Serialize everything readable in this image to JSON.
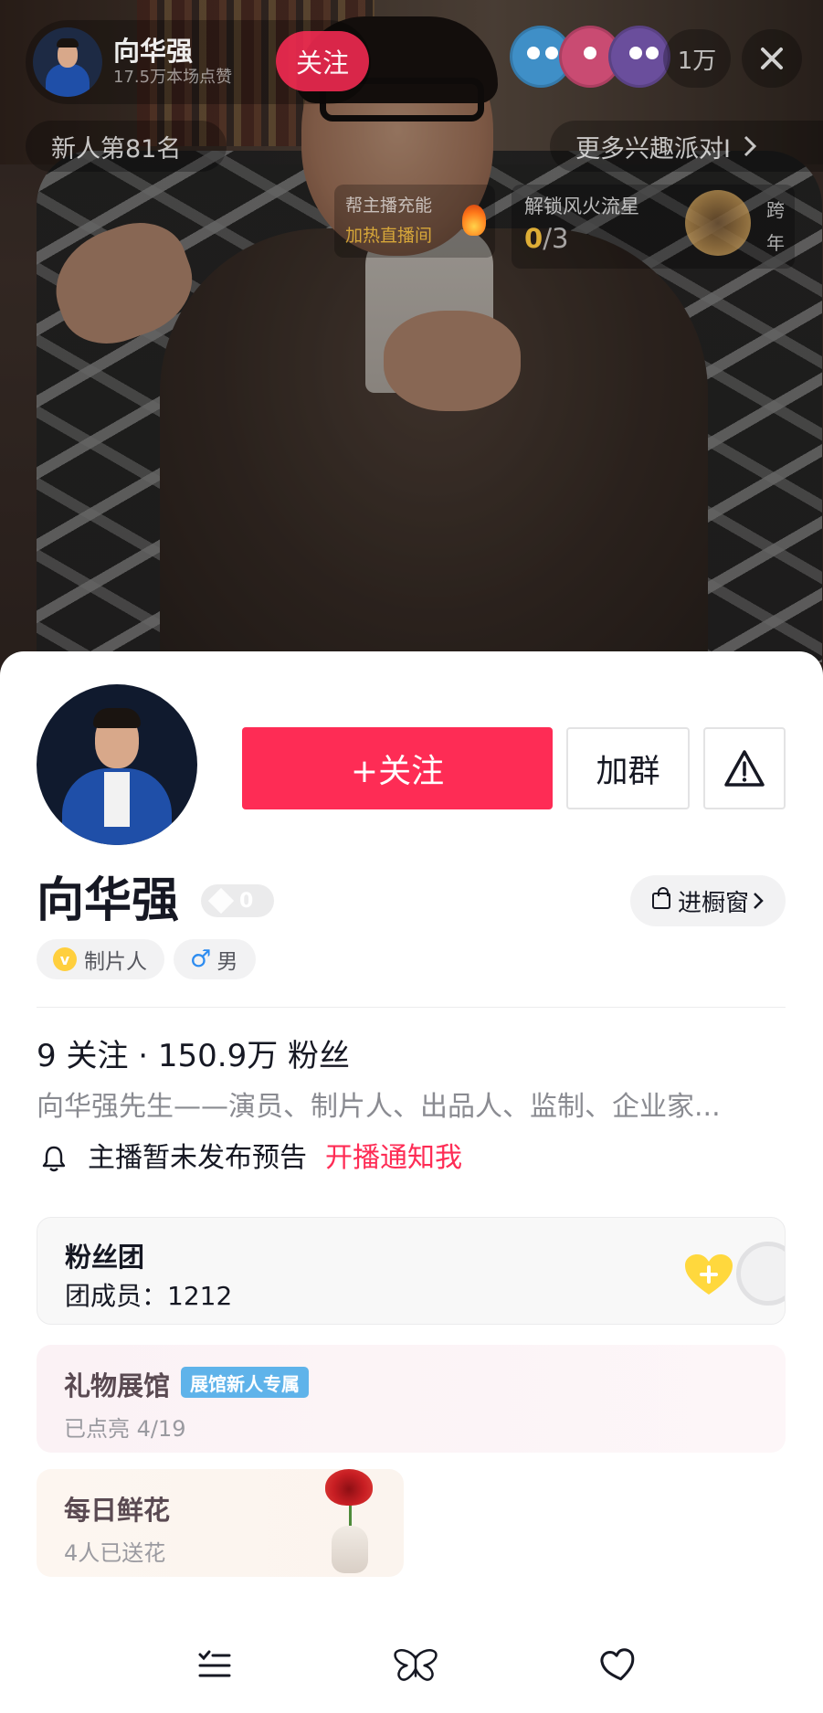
{
  "live": {
    "host_name": "向华强",
    "host_likes": "17.5万本场点赞",
    "follow_label": "关注",
    "viewer_count": "1万",
    "rank_label": "新人第81名",
    "interest_label": "更多兴趣派对I",
    "boost_title": "帮主播充能",
    "boost_sub": "加热直播间",
    "unlock_title": "解锁风火流星",
    "unlock_current": "0",
    "unlock_total": "/3",
    "unlock_side_label": "跨年"
  },
  "profile": {
    "follow_button": "+关注",
    "group_button": "加群",
    "name": "向华强",
    "level": "0",
    "shop_button": "进橱窗",
    "tags": {
      "job": "制片人",
      "gender_icon": "♂",
      "gender": "男"
    },
    "stats": "9 关注 · 150.9万 粉丝",
    "bio": "向华强先生——演员、制片人、出品人、监制、企业家...",
    "notice_text": "主播暂未发布预告",
    "notice_link": "开播通知我"
  },
  "fan_club": {
    "title": "粉丝团",
    "members_label": "团成员：1212"
  },
  "gift_hall": {
    "title": "礼物展馆",
    "tag": "展馆新人专属",
    "progress": "已点亮 4/19"
  },
  "daily_flower": {
    "title": "每日鲜花",
    "count": "4人已送花"
  },
  "colors": {
    "accent": "#fe2c55",
    "text": "#161823",
    "secondary": "#8a8b91",
    "tag_blue": "#5fb3ea"
  },
  "icons": {
    "close": "close-icon",
    "warning": "warning-icon",
    "bell": "bell-icon",
    "nav_list": "list-icon",
    "nav_butterfly": "butterfly-icon",
    "nav_heart": "heart-icon"
  }
}
